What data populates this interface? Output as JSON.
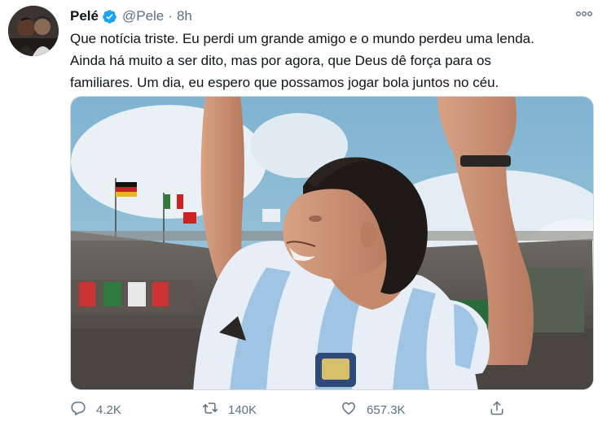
{
  "tweet": {
    "author_name": "Pelé",
    "handle": "@Pele",
    "separator": "·",
    "time": "8h",
    "text_lines": [
      "Que notícia triste. Eu perdi um grande amigo e o mundo perdeu uma lenda.",
      "Ainda há muito a ser dito, mas por agora, que Deus dê força para os",
      "familiares. Um dia, eu espero que possamos jogar bola juntos no céu."
    ]
  },
  "actions": {
    "replies": "4.2K",
    "retweets": "140K",
    "likes": "657.3K"
  },
  "icons": {
    "verified": "verified-badge-icon",
    "more": "more-options-icon",
    "reply": "reply-icon",
    "retweet": "retweet-icon",
    "like": "heart-icon",
    "share": "share-icon"
  },
  "colors": {
    "brand_blue": "#1da1f2",
    "secondary_text": "#5b7083",
    "primary_text": "#0f1419"
  }
}
